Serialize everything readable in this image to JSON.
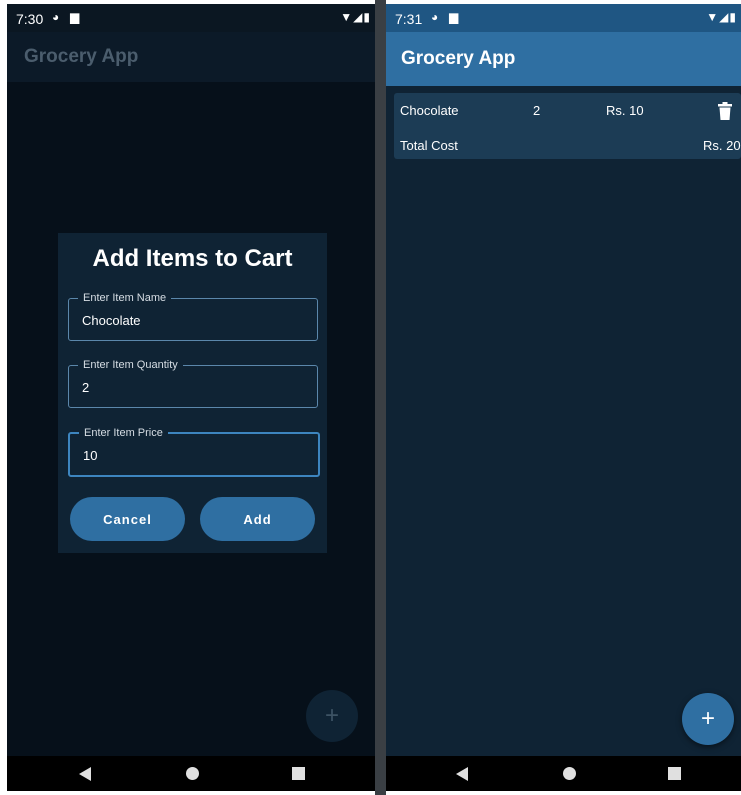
{
  "left_screen": {
    "status": {
      "time": "7:30"
    },
    "app_title": "Grocery App",
    "dialog": {
      "title": "Add Items to Cart",
      "fields": [
        {
          "label": "Enter Item Name",
          "value": "Chocolate"
        },
        {
          "label": "Enter Item Quantity",
          "value": "2"
        },
        {
          "label": "Enter Item Price",
          "value": "10"
        }
      ],
      "cancel_label": "Cancel",
      "add_label": "Add"
    },
    "fab_label": "+"
  },
  "right_screen": {
    "status": {
      "time": "7:31"
    },
    "app_title": "Grocery App",
    "cart": {
      "items": [
        {
          "name": "Chocolate",
          "quantity": "2",
          "price": "Rs. 10"
        }
      ],
      "total_label": "Total Cost",
      "total_value": "Rs. 20"
    },
    "fab_label": "+"
  },
  "icons": {
    "status": [
      "play-store-icon",
      "sd-card-icon",
      "wifi-icon",
      "signal-icon",
      "battery-icon"
    ],
    "nav": [
      "back-icon",
      "home-icon",
      "recents-icon"
    ],
    "delete": "trash-icon",
    "fab": "plus-icon"
  },
  "colors": {
    "primary": "#2f6fa2",
    "surface": "#0f2334",
    "card": "#1c3c55"
  }
}
